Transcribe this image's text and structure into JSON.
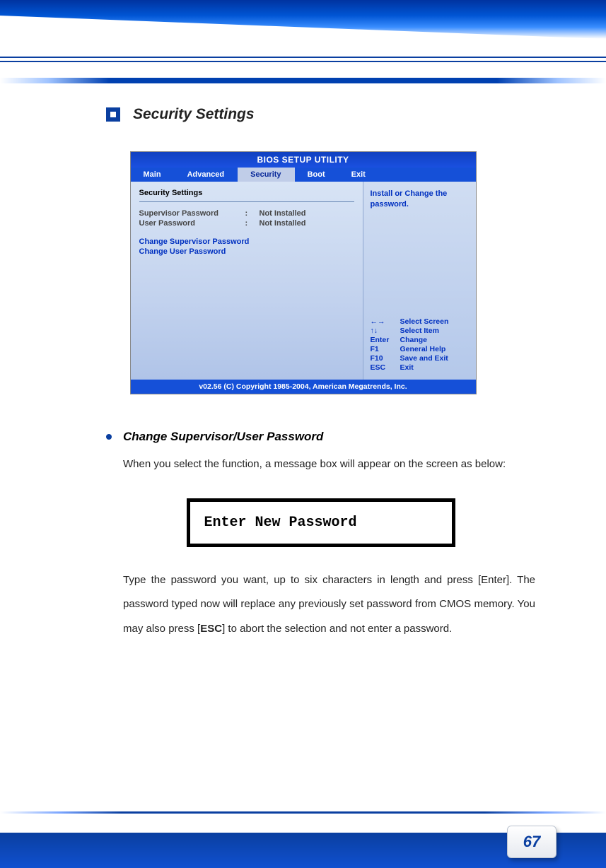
{
  "section": {
    "title": "Security Settings"
  },
  "bios": {
    "title": "BIOS SETUP UTILITY",
    "tabs": [
      "Main",
      "Advanced",
      "Security",
      "Boot",
      "Exit"
    ],
    "activeTab": "Security",
    "panelTitle": "Security Settings",
    "rows": [
      {
        "label": "Supervisor Password",
        "value": "Not Installed"
      },
      {
        "label": "User Password",
        "value": "Not Installed"
      }
    ],
    "links": [
      "Change Supervisor Password",
      "Change User Password"
    ],
    "helpText": "Install or Change the password.",
    "keys": [
      {
        "key": "←→",
        "desc": "Select Screen"
      },
      {
        "key": "↑↓",
        "desc": "Select Item"
      },
      {
        "key": "Enter",
        "desc": "Change"
      },
      {
        "key": "F1",
        "desc": "General Help"
      },
      {
        "key": "F10",
        "desc": "Save and Exit"
      },
      {
        "key": "ESC",
        "desc": "Exit"
      }
    ],
    "footer": "v02.56 (C) Copyright  1985-2004, American Megatrends, Inc."
  },
  "bullet": {
    "title": "Change Supervisor/User Password",
    "para1": "When you select the function, a message box will appear on the screen as below:",
    "box": "Enter New Password",
    "para2a": "Type the password you want, up to six characters in length and press [Enter].  The password typed now will replace any previously set password from CMOS memory. You may also press [",
    "para2b": "ESC",
    "para2c": "] to abort the selection and not enter a password."
  },
  "page": {
    "number": "67"
  }
}
